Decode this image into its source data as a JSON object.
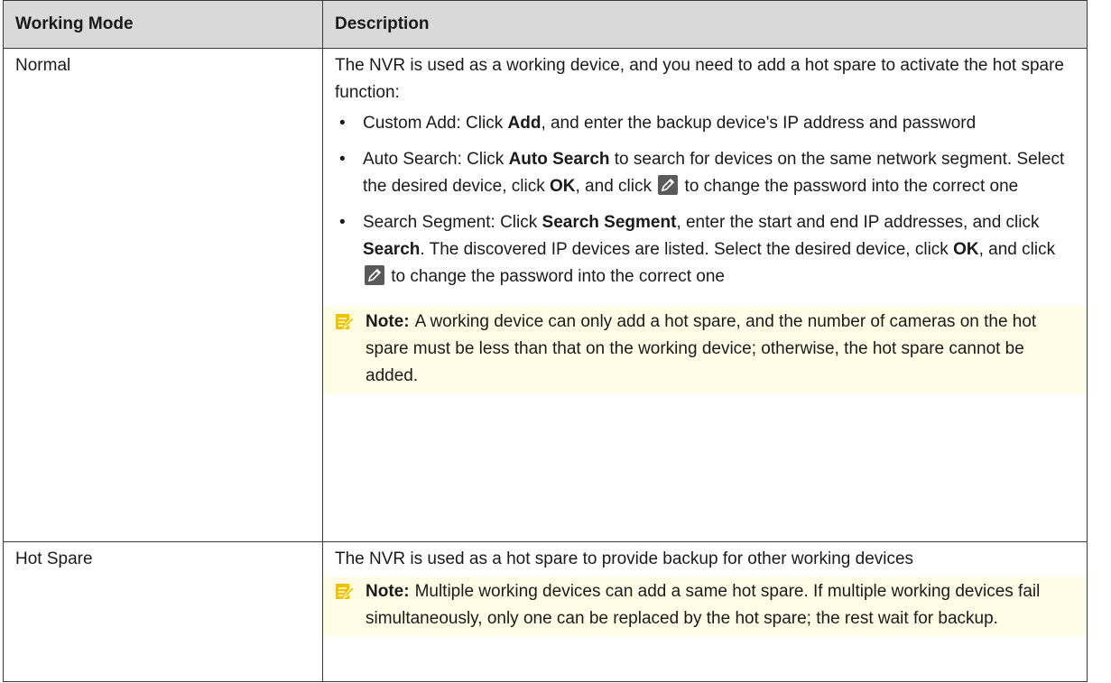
{
  "header": {
    "col1": "Working Mode",
    "col2": "Description"
  },
  "rows": [
    {
      "mode": "Normal",
      "intro": "The NVR is used as a working device, and you need to add a hot spare to activate the hot spare function:",
      "items": [
        {
          "pre": "Custom Add: Click ",
          "b1": "Add",
          "mid": ", and enter the backup device's IP address and password"
        },
        {
          "pre": "Auto Search: Click ",
          "b1": "Auto Search",
          "mid": " to search for devices on the same network segment. Select the desired device, click ",
          "b2": "OK",
          "mid2": ", and click ",
          "post": " to change the password into the correct one"
        },
        {
          "pre": "Search Segment: Click ",
          "b1": "Search Segment",
          "mid": ", enter the start and end IP addresses, and click ",
          "b2": "Search",
          "mid2": ". The discovered IP devices are listed. Select the desired device, click ",
          "b3": "OK",
          "mid3": ", and click ",
          "post": " to change the password into the correct one"
        }
      ],
      "note_label": "Note:",
      "note_text": "A working device can only add a hot spare, and the number of cameras on the hot spare must be less than that on the working device; otherwise, the hot spare cannot be added."
    },
    {
      "mode": "Hot Spare",
      "intro": "The NVR is used as a hot spare to provide backup for other working devices",
      "note_label": "Note:",
      "note_text": "Multiple working devices can add a same hot spare. If multiple working devices fail simultaneously, only one can be replaced by the hot spare; the rest wait for backup."
    }
  ],
  "icons": {
    "note": "note-pencil-icon",
    "edit": "edit-pencil-icon"
  },
  "colors": {
    "header_bg": "#d9d9d9",
    "note_bg": "#fffde6",
    "note_icon": "#f2c200"
  }
}
